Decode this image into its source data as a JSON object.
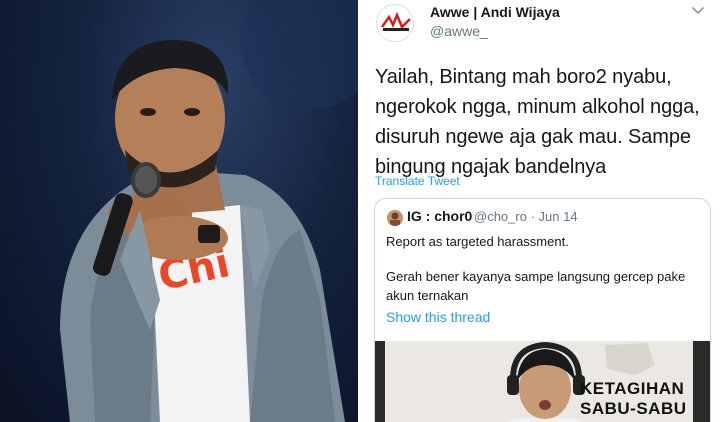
{
  "tweet": {
    "display_name": "Awwe | Andi Wijaya",
    "handle": "@awwe_",
    "avatar_logo_text": "AWWE",
    "text": "Yailah, Bintang mah boro2 nyabu, ngerokok ngga, minum alkohol ngga, disuruh ngewe aja gak mau. Sampe bingung ngajak bandelnya",
    "translate_label": "Translate Tweet",
    "menu_icon": "chevron-down-icon"
  },
  "quoted_tweet": {
    "display_name": "IG : chor0",
    "handle": "@cho_ro",
    "date": "· Jun 14",
    "line1": "Report as targeted harassment.",
    "line2": "Gerah bener kayanya sampe langsung gercep pake akun ternakan",
    "show_thread_label": "Show this thread",
    "media_text_line1": "KETAGIHAN",
    "media_text_line2": "SABU-SABU"
  },
  "photo": {
    "shirt_text": "Chi"
  },
  "colors": {
    "link": "#1da1f2",
    "secondary_text": "#657786",
    "border": "#ccd6dd",
    "stage_background": "#15233f"
  }
}
